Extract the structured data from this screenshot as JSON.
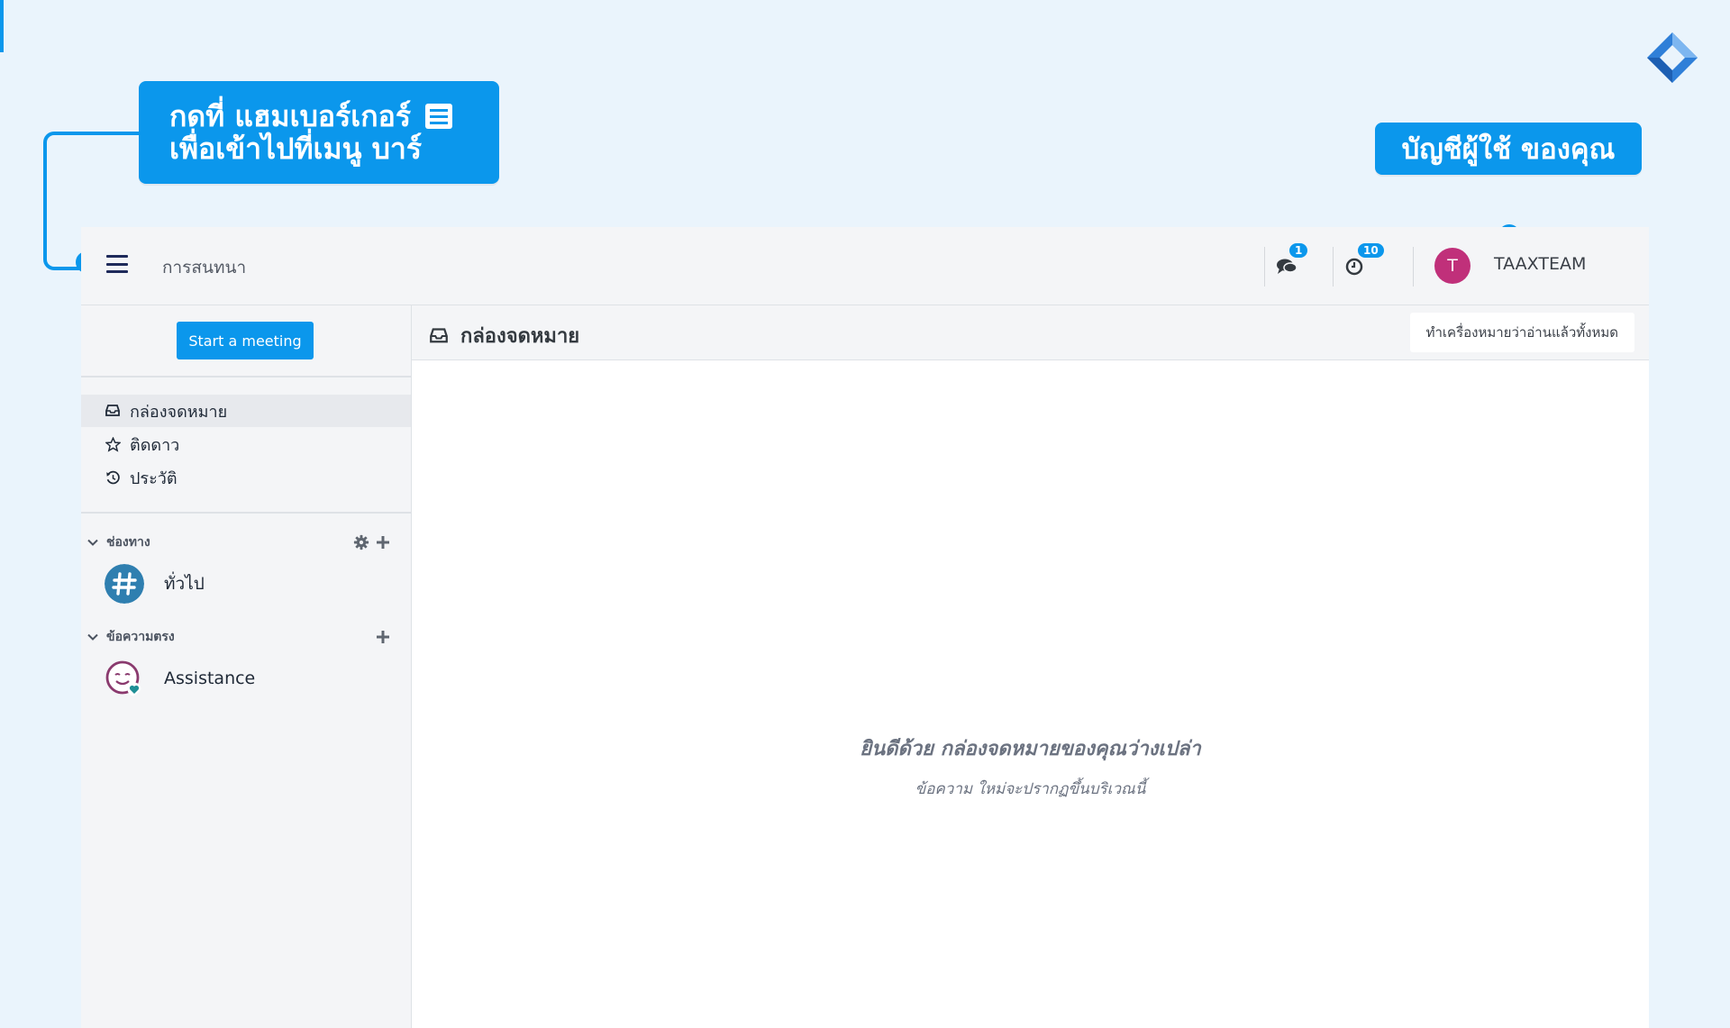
{
  "callouts": {
    "hamburger_line1": "กดที่ แฮมเบอร์เกอร์",
    "hamburger_line2": "เพื่อเข้าไปที่เมนู บาร์",
    "account": "บัญชีผู้ใช้ ของคุณ"
  },
  "topbar": {
    "title": "การสนทนา",
    "messages_badge": "1",
    "activity_badge": "10",
    "avatar_initial": "T",
    "username": "TAAXTEAM"
  },
  "sidebar": {
    "start_meeting_label": "Start a meeting",
    "nav": [
      {
        "label": "กล่องจดหมาย",
        "icon": "inbox-icon"
      },
      {
        "label": "ติดดาว",
        "icon": "star-icon"
      },
      {
        "label": "ประวัติ",
        "icon": "history-icon"
      }
    ],
    "channels_heading": "ช่องทาง",
    "channels": [
      {
        "label": "ทั่วไป",
        "icon": "hashtag-icon"
      }
    ],
    "dm_heading": "ข้อความตรง",
    "direct_messages": [
      {
        "label": "Assistance",
        "icon": "bot-avatar-icon"
      }
    ]
  },
  "main": {
    "title": "กล่องจดหมาย",
    "mark_all_read_label": "ทำเครื่องหมายว่าอ่านแล้วทั้งหมด",
    "empty_title": "ยินดีด้วย กล่องจดหมายของคุณว่างเปล่า",
    "empty_subtitle": "ข้อความ ใหม่จะปรากฏขึ้นบริเวณนี้"
  },
  "colors": {
    "accent": "#0b97ec",
    "page_bg": "#eaf4fc",
    "avatar": "#c0307a",
    "channel_avatar": "#2f7fb0"
  }
}
